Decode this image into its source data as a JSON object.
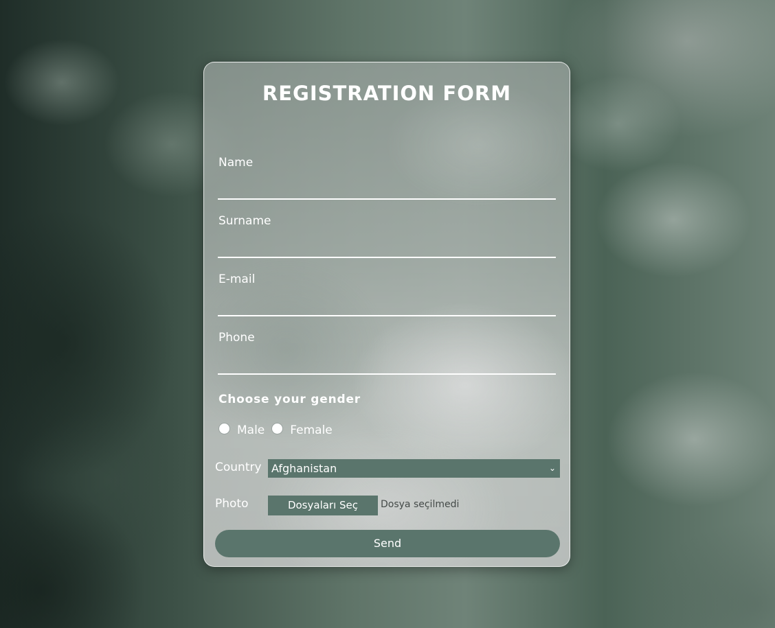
{
  "form": {
    "title": "REGISTRATION FORM",
    "fields": [
      {
        "label": "Name",
        "value": ""
      },
      {
        "label": "Surname",
        "value": ""
      },
      {
        "label": "E-mail",
        "value": ""
      },
      {
        "label": "Phone",
        "value": ""
      }
    ],
    "gender": {
      "heading": "Choose your gender",
      "options": [
        "Male",
        "Female"
      ]
    },
    "country": {
      "label": "Country",
      "selected": "Afghanistan"
    },
    "photo": {
      "label": "Photo",
      "button_label": "Dosyaları Seç",
      "status": "Dosya seçilmedi"
    },
    "submit_label": "Send"
  },
  "icons": {
    "select_chevron": "chevron-down-icon"
  },
  "colors": {
    "accent": "#5a756c",
    "text": "#ffffff",
    "file_status_text": "#444a48"
  }
}
